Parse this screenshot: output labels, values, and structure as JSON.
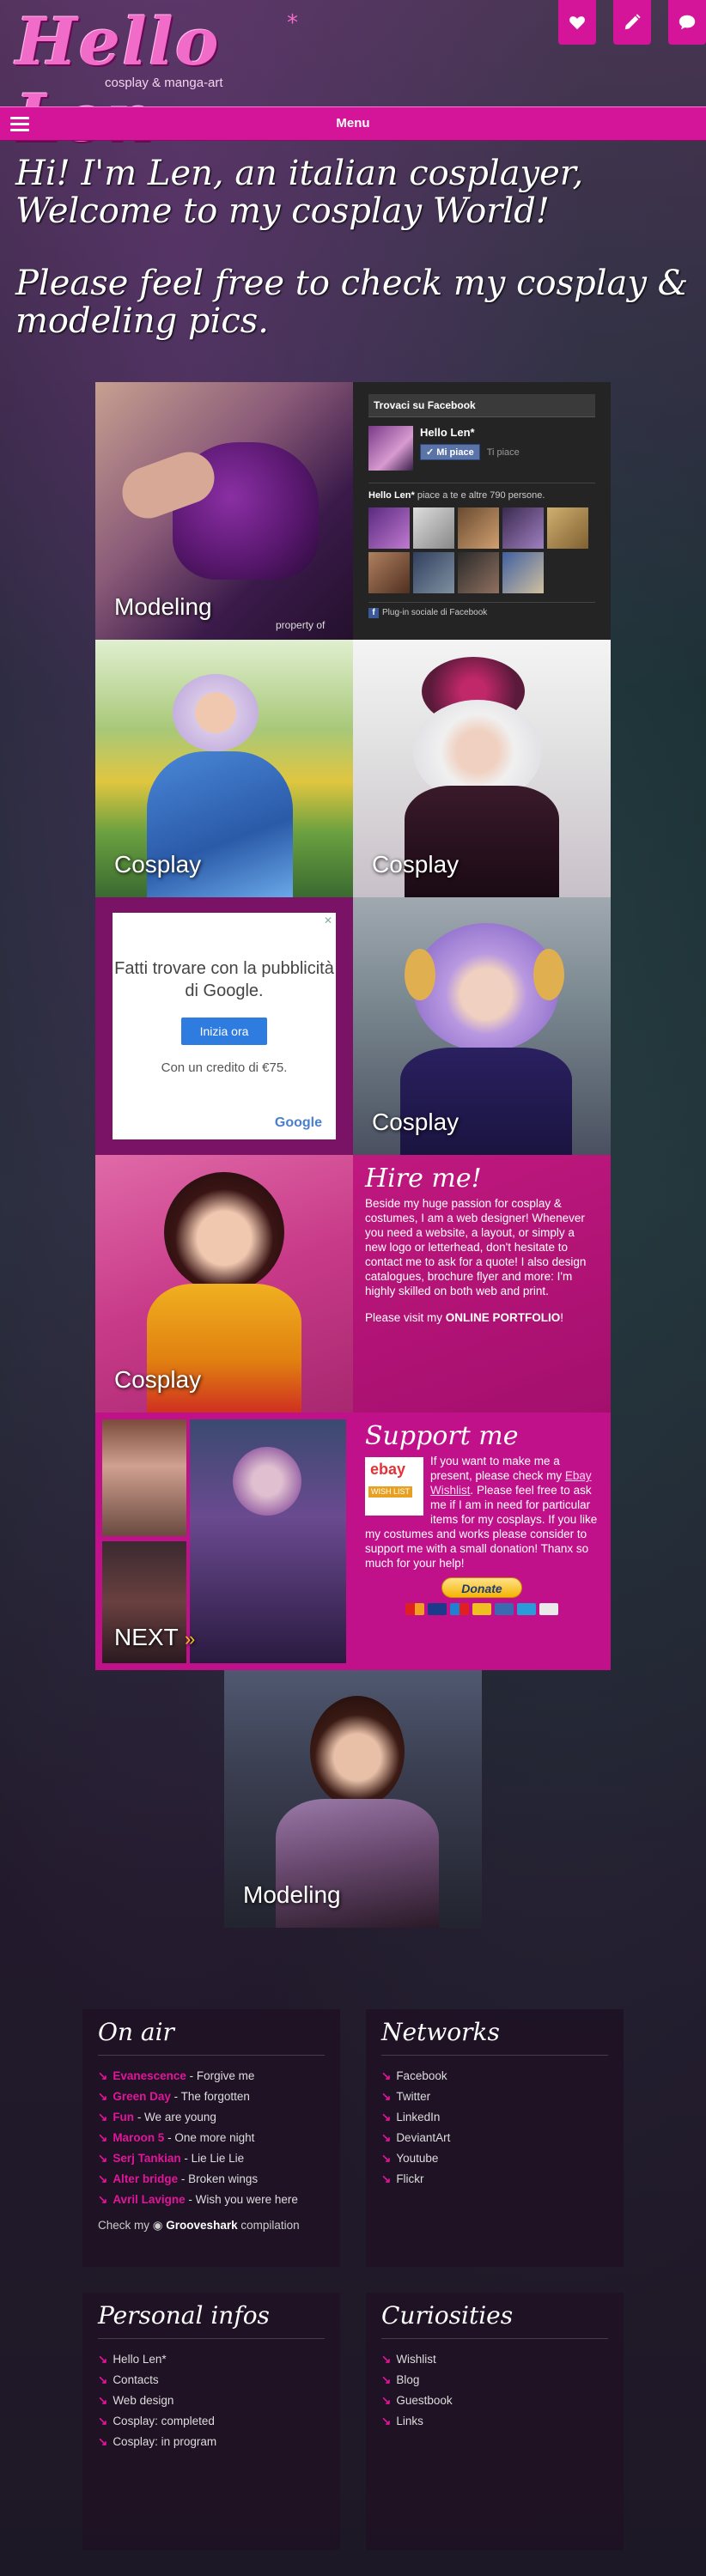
{
  "header": {
    "logo_text": "Hello Len",
    "logo_star": "*",
    "logo_sub": "cosplay & manga-art",
    "icons": [
      "heart-icon",
      "pencil-icon",
      "chat-icon"
    ]
  },
  "menu": {
    "label": "Menu"
  },
  "welcome": {
    "line1": "Hi! I'm Len, an italian cosplayer, Welcome to my cosplay World!",
    "line2": "Please feel free to check my cosplay & modeling pics."
  },
  "tiles": {
    "modeling1": "Modeling",
    "property": "property of",
    "cosplay1": "Cosplay",
    "cosplay2": "Cosplay",
    "cosplay3": "Cosplay",
    "cosplay4": "Cosplay",
    "next": "NEXT",
    "modeling2": "Modeling"
  },
  "facebook": {
    "title": "Trovaci su Facebook",
    "page_name": "Hello Len*",
    "like": "Mi piace",
    "ti_piace": "Ti piace",
    "count_name": "Hello Len*",
    "count_text": " piace a te e altre 790 persone.",
    "plugin": "Plug-in sociale di Facebook"
  },
  "ad": {
    "close": "✕",
    "headline": "Fatti trovare con la pubblicità di Google.",
    "button": "Inizia ora",
    "sub": "Con un credito di €75.",
    "brand": "Google"
  },
  "hire": {
    "title": "Hire me!",
    "p1": "Beside my huge passion for cosplay & costumes, I am a web designer! Whenever you need a website, a layout, or simply a new logo or letterhead, don't hesitate to contact me to ask for a quote! I also design catalogues, brochure flyer and more: I'm highly skilled on both web and print.",
    "p2_pre": "Please visit my ",
    "p2_link": "ONLINE PORTFOLIO",
    "p2_post": "!"
  },
  "support": {
    "title": "Support me",
    "ebay1": "ebay",
    "ebay2": "WISH LIST",
    "t1": "If you want to make me a present, please check my ",
    "link": "Ebay Wishlist",
    "t2": ". Please feel free to ask me if I am in need for particular items for my cosplays. If you like my costumes and works please consider to support me with a small donation! Thanx so much for your help!",
    "donate": "Donate"
  },
  "on_air": {
    "title": "On air",
    "items": [
      {
        "artist": "Evanescence",
        "song": " - Forgive me"
      },
      {
        "artist": "Green Day",
        "song": " - The forgotten"
      },
      {
        "artist": "Fun",
        "song": " - We are young"
      },
      {
        "artist": "Maroon 5",
        "song": " - One more night"
      },
      {
        "artist": "Serj Tankian",
        "song": " - Lie Lie Lie"
      },
      {
        "artist": "Alter bridge",
        "song": " - Broken wings"
      },
      {
        "artist": "Avril Lavigne",
        "song": " - Wish you were here"
      }
    ],
    "gs_pre": "Check my ",
    "gs_brand": "Grooveshark",
    "gs_post": " compilation"
  },
  "networks": {
    "title": "Networks",
    "items": [
      "Facebook",
      "Twitter",
      "LinkedIn",
      "DeviantArt",
      "Youtube",
      "Flickr"
    ]
  },
  "personal": {
    "title": "Personal infos",
    "items": [
      "Hello Len*",
      "Contacts",
      "Web design",
      "Cosplay: completed",
      "Cosplay: in program"
    ]
  },
  "curiosities": {
    "title": "Curiosities",
    "items": [
      "Wishlist",
      "Blog",
      "Guestbook",
      "Links"
    ]
  },
  "colors": {
    "accent": "#d4159a",
    "hire_bg": "#b3147a",
    "support_bg": "#c0118a"
  }
}
